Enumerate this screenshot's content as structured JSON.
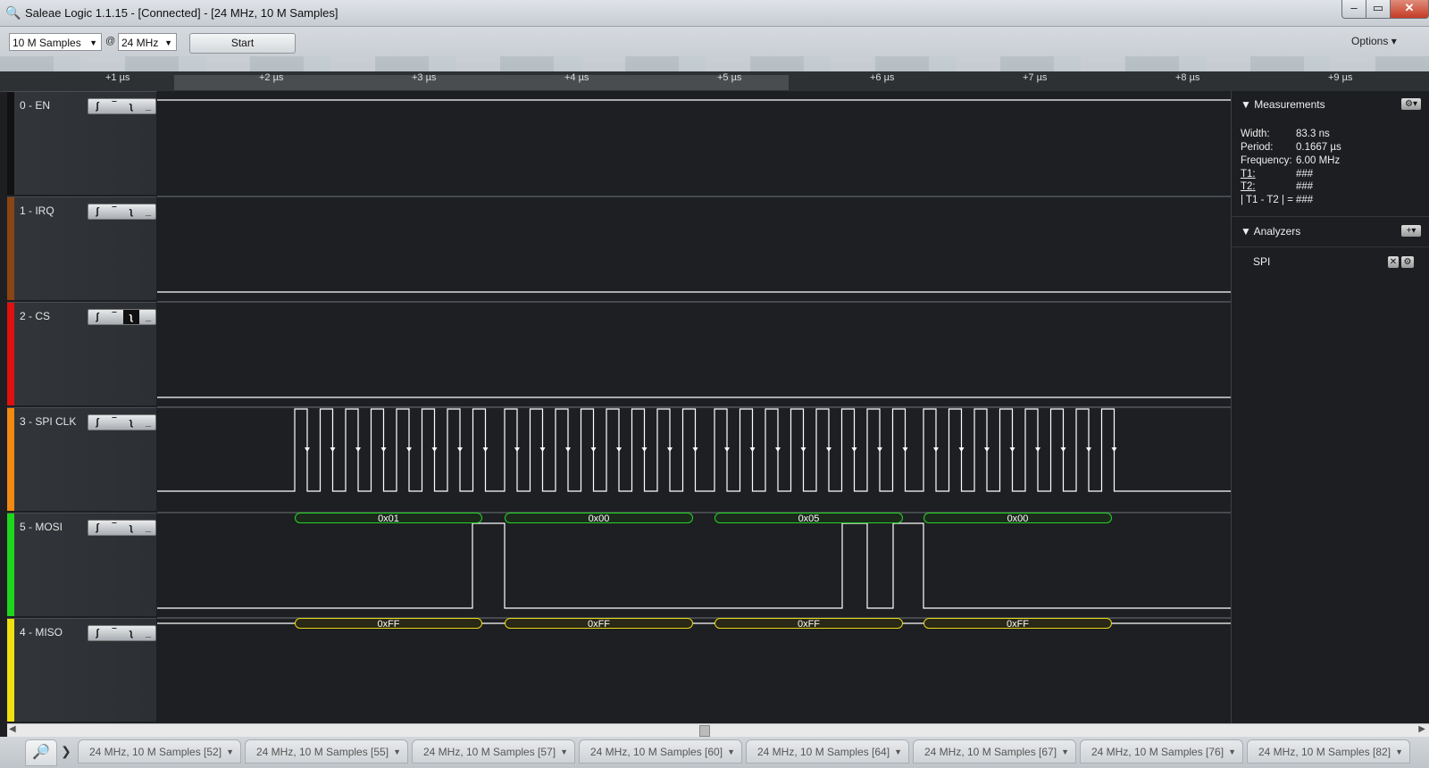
{
  "window": {
    "title": "Saleae Logic 1.1.15 - [Connected] - [24 MHz, 10 M Samples]",
    "minimize": "–",
    "maximize": "▭",
    "close": "✕"
  },
  "toolbar": {
    "samples": "10 M Samples",
    "at": "@",
    "rate": "24 MHz",
    "start": "Start",
    "options": "Options ▾"
  },
  "ruler": {
    "ticks": [
      "+1 µs",
      "+2 µs",
      "+3 µs",
      "+4 µs",
      "+5 µs",
      "+6 µs",
      "+7 µs",
      "+8 µs",
      "+9 µs"
    ]
  },
  "channels": [
    {
      "name": "0 - EN",
      "color": "#111111"
    },
    {
      "name": "1 - IRQ",
      "color": "#8b4513"
    },
    {
      "name": "2 - CS",
      "color": "#e01010"
    },
    {
      "name": "3 - SPI CLK",
      "color": "#f08a12"
    },
    {
      "name": "5 - MOSI",
      "color": "#1fd61f"
    },
    {
      "name": "4 - MISO",
      "color": "#f0e010"
    }
  ],
  "decoded": {
    "mosi": [
      "0x01",
      "0x00",
      "0x05",
      "0x00"
    ],
    "miso": [
      "0xFF",
      "0xFF",
      "0xFF",
      "0xFF"
    ]
  },
  "measurements": {
    "header": "Measurements",
    "width_label": "Width:",
    "width": "83.3 ns",
    "period_label": "Period:",
    "period": "0.1667 µs",
    "freq_label": "Frequency:",
    "freq": "6.00 MHz",
    "t1_label": "T1",
    "t1": "###",
    "t2_label": "T2",
    "t2": "###",
    "diff_label": "| T1 - T2 | =",
    "diff": "###"
  },
  "analyzers": {
    "header": "Analyzers",
    "items": [
      "SPI"
    ]
  },
  "tabs": [
    "24 MHz, 10 M Samples [52]",
    "24 MHz, 10 M Samples [55]",
    "24 MHz, 10 M Samples [57]",
    "24 MHz, 10 M Samples [60]",
    "24 MHz, 10 M Samples [64]",
    "24 MHz, 10 M Samples [67]",
    "24 MHz, 10 M Samples [76]",
    "24 MHz, 10 M Samples [82]"
  ]
}
